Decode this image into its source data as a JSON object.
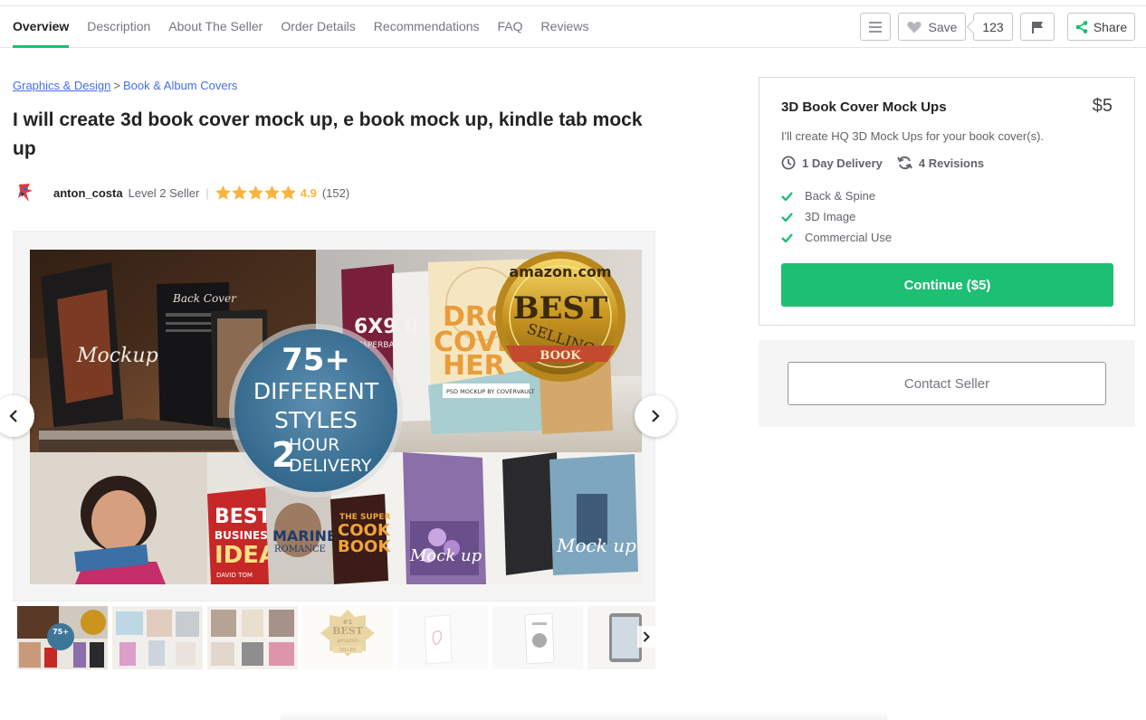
{
  "nav": {
    "tabs": [
      {
        "label": "Overview",
        "active": true
      },
      {
        "label": "Description"
      },
      {
        "label": "About The Seller"
      },
      {
        "label": "Order Details"
      },
      {
        "label": "Recommendations"
      },
      {
        "label": "FAQ"
      },
      {
        "label": "Reviews"
      }
    ],
    "actions": {
      "menu_icon": "hamburger-icon",
      "save_label": "Save",
      "save_icon": "heart-icon",
      "save_count": "123",
      "flag_icon": "flag-icon",
      "share_label": "Share",
      "share_icon": "share-icon"
    }
  },
  "breadcrumb": {
    "category": "Graphics & Design",
    "separator": ">",
    "subcategory": "Book & Album Covers"
  },
  "gig": {
    "title": "I will create 3d book cover mock up, e book mock up, kindle tab mock up"
  },
  "seller": {
    "name": "anton_costa",
    "level": "Level 2 Seller",
    "divider": "|",
    "rating": "4.9",
    "stars": 5,
    "reviews": "(152)"
  },
  "gallery": {
    "overlay": {
      "line1": "75+",
      "line2": "DIFFERENT",
      "line3": "STYLES",
      "line4_big": "2",
      "line4_a": "HOUR",
      "line4_b": "DELIVERY"
    },
    "badge": {
      "top": "amazon.com",
      "main": "BEST",
      "sub": "SELLING",
      "ribbon": "BOOK"
    },
    "book_texts": {
      "mockup": "Mockup",
      "back_cover": "Back Cover",
      "six_by_nine": "6X9 II",
      "paperback": "PAPERBACK",
      "drop": "DRO",
      "cover": "COVE",
      "here": "HER",
      "psd": "PSD MOCKUP BY COVERVAULT",
      "best": "BEST",
      "business": "BUSINESS",
      "idea": "IDEA",
      "author": "DAVID TOM",
      "marine": "MARINE",
      "romance": "ROMANCE",
      "super": "THE SUPER",
      "cook": "COOK",
      "book": "BOOK",
      "mockup2": "Mock up",
      "mockup3": "Mock up"
    },
    "thumb_count": 7,
    "thumb_badge": {
      "one": "#1",
      "best": "BEST",
      "amazon": "amazon",
      "seller": "SELLER"
    }
  },
  "package": {
    "name": "3D Book Cover Mock Ups",
    "price": "$5",
    "description": "I'll create HQ 3D Mock Ups for your book cover(s).",
    "delivery": "1 Day Delivery",
    "revisions": "4 Revisions",
    "features": [
      "Back & Spine",
      "3D Image",
      "Commercial Use"
    ],
    "continue_label": "Continue ($5)"
  },
  "contact": {
    "label": "Contact Seller"
  },
  "colors": {
    "accent_green": "#1dbf73",
    "star_yellow": "#ffb33e",
    "link_blue": "#446ee7"
  }
}
